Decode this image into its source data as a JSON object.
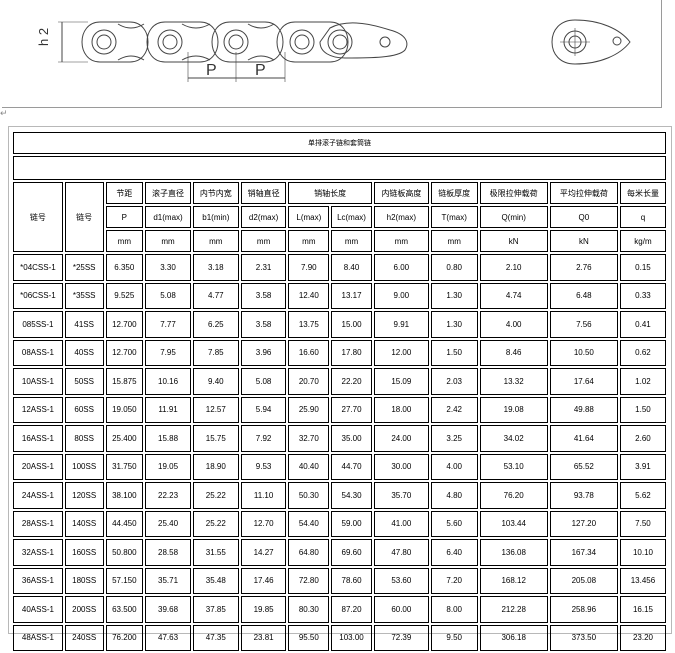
{
  "drawing": {
    "h2_label": "h 2",
    "pitch_label_left": "P",
    "pitch_label_right": "P"
  },
  "table": {
    "title": "单排滚子链和套筒链",
    "headers": {
      "chain_no": "链号",
      "chain_no2": "链号",
      "pitch": "节距",
      "roller_dia": "滚子直径",
      "inner_width": "内节内宽",
      "pin_dia": "销轴直径",
      "pin_length": "销轴长度",
      "plate_height": "内链板高度",
      "plate_thickness": "链板厚度",
      "ultimate_tensile": "极限拉伸载荷",
      "avg_tensile": "平均拉伸载荷",
      "weight": "每米长量"
    },
    "symbols": [
      "P",
      "d1(max)",
      "b1(min)",
      "d2(max)",
      "L(max)",
      "Lc(max)",
      "h2(max)",
      "T(max)",
      "Q(min)",
      "Q0",
      "q"
    ],
    "units": [
      "mm",
      "mm",
      "mm",
      "mm",
      "mm",
      "mm",
      "mm",
      "mm",
      "kN",
      "kN",
      "kg/m"
    ],
    "rows": [
      [
        "*04CSS-1",
        "*25SS",
        "6.350",
        "3.30",
        "3.18",
        "2.31",
        "7.90",
        "8.40",
        "6.00",
        "0.80",
        "2.10",
        "2.76",
        "0.15"
      ],
      [
        "*06CSS-1",
        "*35SS",
        "9.525",
        "5.08",
        "4.77",
        "3.58",
        "12.40",
        "13.17",
        "9.00",
        "1.30",
        "4.74",
        "6.48",
        "0.33"
      ],
      [
        "085SS-1",
        "41SS",
        "12.700",
        "7.77",
        "6.25",
        "3.58",
        "13.75",
        "15.00",
        "9.91",
        "1.30",
        "4.00",
        "7.56",
        "0.41"
      ],
      [
        "08ASS-1",
        "40SS",
        "12.700",
        "7.95",
        "7.85",
        "3.96",
        "16.60",
        "17.80",
        "12.00",
        "1.50",
        "8.46",
        "10.50",
        "0.62"
      ],
      [
        "10ASS-1",
        "50SS",
        "15.875",
        "10.16",
        "9.40",
        "5.08",
        "20.70",
        "22.20",
        "15.09",
        "2.03",
        "13.32",
        "17.64",
        "1.02"
      ],
      [
        "12ASS-1",
        "60SS",
        "19.050",
        "11.91",
        "12.57",
        "5.94",
        "25.90",
        "27.70",
        "18.00",
        "2.42",
        "19.08",
        "49.88",
        "1.50"
      ],
      [
        "16ASS-1",
        "80SS",
        "25.400",
        "15.88",
        "15.75",
        "7.92",
        "32.70",
        "35.00",
        "24.00",
        "3.25",
        "34.02",
        "41.64",
        "2.60"
      ],
      [
        "20ASS-1",
        "100SS",
        "31.750",
        "19.05",
        "18.90",
        "9.53",
        "40.40",
        "44.70",
        "30.00",
        "4.00",
        "53.10",
        "65.52",
        "3.91"
      ],
      [
        "24ASS-1",
        "120SS",
        "38.100",
        "22.23",
        "25.22",
        "11.10",
        "50.30",
        "54.30",
        "35.70",
        "4.80",
        "76.20",
        "93.78",
        "5.62"
      ],
      [
        "28ASS-1",
        "140SS",
        "44.450",
        "25.40",
        "25.22",
        "12.70",
        "54.40",
        "59.00",
        "41.00",
        "5.60",
        "103.44",
        "127.20",
        "7.50"
      ],
      [
        "32ASS-1",
        "160SS",
        "50.800",
        "28.58",
        "31.55",
        "14.27",
        "64.80",
        "69.60",
        "47.80",
        "6.40",
        "136.08",
        "167.34",
        "10.10"
      ],
      [
        "36ASS-1",
        "180SS",
        "57.150",
        "35.71",
        "35.48",
        "17.46",
        "72.80",
        "78.60",
        "53.60",
        "7.20",
        "168.12",
        "205.08",
        "13.456"
      ],
      [
        "40ASS-1",
        "200SS",
        "63.500",
        "39.68",
        "37.85",
        "19.85",
        "80.30",
        "87.20",
        "60.00",
        "8.00",
        "212.28",
        "258.96",
        "16.15"
      ],
      [
        "48ASS-1",
        "240SS",
        "76.200",
        "47.63",
        "47.35",
        "23.81",
        "95.50",
        "103.00",
        "72.39",
        "9.50",
        "306.18",
        "373.50",
        "23.20"
      ]
    ]
  }
}
